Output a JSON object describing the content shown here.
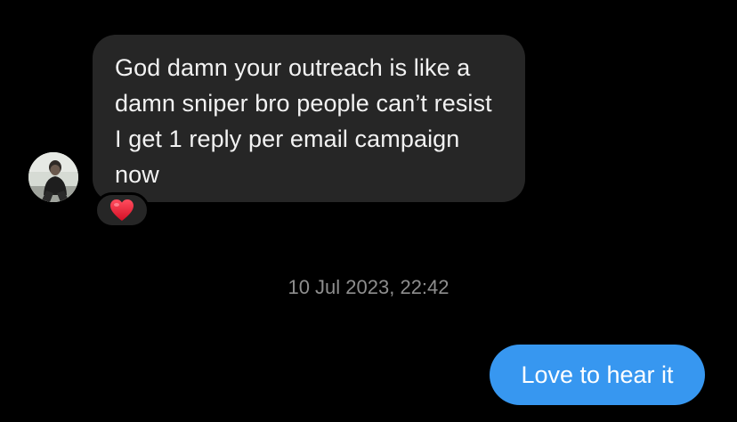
{
  "conversation": {
    "incoming_message": {
      "text": "God damn your outreach is like a damn sniper bro people can’t resist I get 1 reply per email campaign now",
      "reaction": "heart"
    },
    "timestamp": "10 Jul 2023, 22:42",
    "outgoing_message": {
      "text": "Love to hear it"
    }
  },
  "colors": {
    "background": "#000000",
    "incoming_bubble": "#262626",
    "outgoing_bubble": "#3797f0",
    "timestamp_text": "#8e8e8e",
    "reaction_heart": "#e8112d"
  },
  "icons": {
    "avatar": "user-photo-avatar",
    "reaction": "red-heart-icon"
  }
}
